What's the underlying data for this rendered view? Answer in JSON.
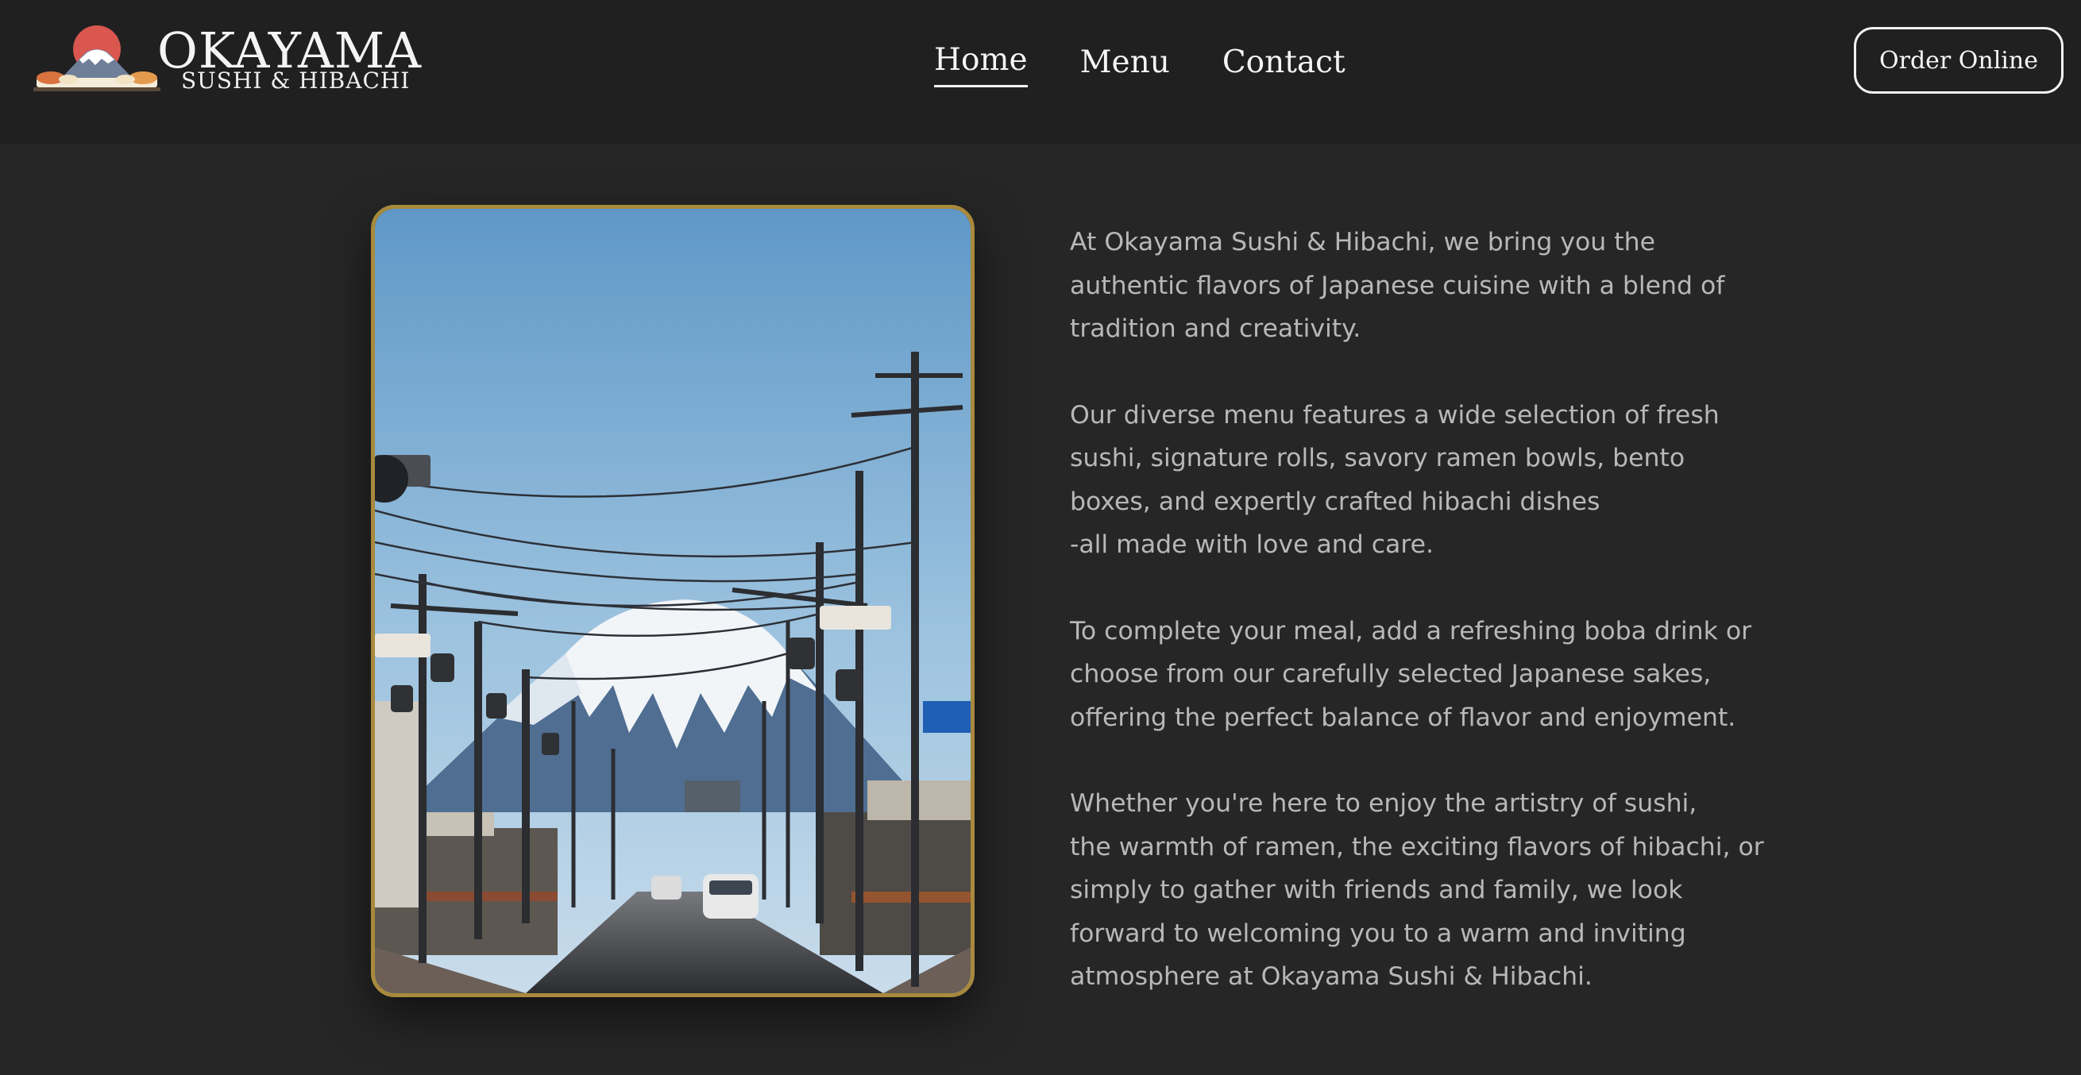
{
  "brand": {
    "name": "OKAYAMA",
    "tagline": "SUSHI & HIBACHI"
  },
  "nav": {
    "items": [
      {
        "label": "Home",
        "active": true
      },
      {
        "label": "Menu",
        "active": false
      },
      {
        "label": "Contact",
        "active": false
      }
    ]
  },
  "order_button": {
    "label": "Order Online"
  },
  "hero_image": {
    "subject": "street view toward snow-capped Mount Fuji with utility poles and street lamps"
  },
  "about": {
    "paragraphs": [
      "At Okayama Sushi & Hibachi, we bring you the\nauthentic flavors of Japanese cuisine with a blend of\ntradition and creativity.",
      "Our diverse menu features a wide selection of fresh\nsushi, signature rolls, savory ramen bowls, bento\nboxes, and expertly crafted hibachi dishes\n-all made with love and care.",
      "To complete your meal, add a refreshing boba drink or\nchoose from our carefully selected Japanese sakes,\noffering the perfect balance of flavor and enjoyment.",
      "Whether you're here to enjoy the artistry of sushi,\nthe warmth of ramen, the exciting flavors of hibachi, or\nsimply to gather with friends and family, we look\nforward to welcoming you to a warm and inviting\natmosphere at Okayama Sushi & Hibachi."
    ]
  },
  "colors": {
    "page_background": "#262626",
    "header_background": "#202020",
    "image_border": "#a8893d",
    "body_text": "#b8b8b8",
    "nav_text": "#f5f5f5"
  }
}
